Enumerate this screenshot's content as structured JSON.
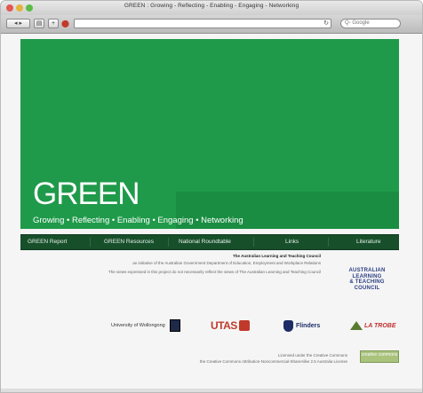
{
  "window": {
    "title": "GREEN : Growing - Reflecting - Enabling - Engaging - Networking"
  },
  "toolbar": {
    "back_forward": "◂ ▸",
    "reader": "▤",
    "add": "+",
    "search_placeholder": "Q- Google"
  },
  "hero": {
    "title": "GREEN",
    "tagline": "Growing • Reflecting • Enabling • Engaging • Networking",
    "background_color": "#1f9a4a"
  },
  "nav": {
    "items": [
      {
        "label": "GREEN Report"
      },
      {
        "label": "GREEN Resources"
      },
      {
        "label": "National Roundtable"
      },
      {
        "label": "Links"
      },
      {
        "label": "Literature"
      }
    ]
  },
  "footer": {
    "line1_bold": "The Australian Learning and Teaching Council",
    "line2": "an initiative of the Australian Government Department of Education, Employment and Workplace Relations",
    "line3": "The views expressed in this project do not necessarily reflect the views of The Australian Learning and Teaching Council",
    "altc_logo": [
      "AUSTRALIAN",
      "LEARNING",
      "& TEACHING",
      "COUNCIL"
    ],
    "licence_line1": "Licensed under the Creative Commons",
    "licence_line2": "the Creative Commons Attribution-Noncommercial-ShareAlike 2.5 Australia License",
    "cc_badge": "creative commons"
  },
  "partners": [
    {
      "name": "University of Wollongong"
    },
    {
      "name": "UTAS"
    },
    {
      "name": "Flinders"
    },
    {
      "name": "LA TROBE"
    }
  ]
}
